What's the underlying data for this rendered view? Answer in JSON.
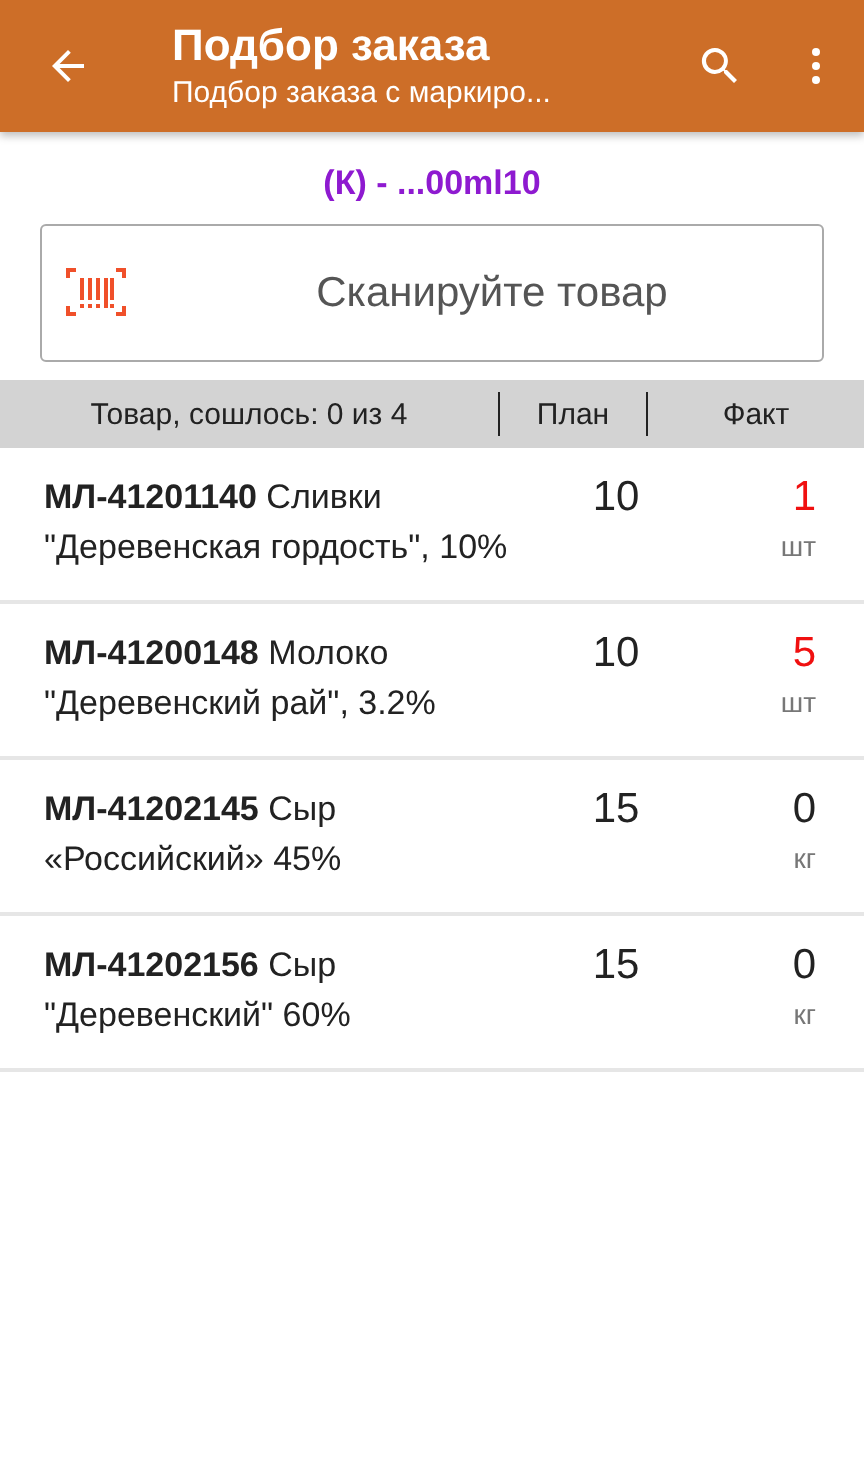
{
  "app_bar": {
    "title": "Подбор заказа",
    "subtitle": "Подбор заказа с маркиро..."
  },
  "order_code": "(К) - ...00ml10",
  "scan_field": {
    "placeholder": "Сканируйте товар"
  },
  "table": {
    "columns": [
      "Товар, сошлось: 0 из 4",
      "План",
      "Факт"
    ],
    "rows": [
      {
        "name": "**МЛ-41201140** Сливки \"Деревенская гордость\", 10%",
        "plan": "10",
        "fact": "1",
        "unit": "шт",
        "alert": true
      },
      {
        "name": "**МЛ-41200148** Молоко \"Деревенский рай\", 3.2%",
        "plan": "10",
        "fact": "5",
        "unit": "шт",
        "alert": true
      },
      {
        "name": "**МЛ-41202145** Сыр «Российский» 45%",
        "plan": "15",
        "fact": "0",
        "unit": "кг",
        "alert": false
      },
      {
        "name": "**МЛ-41202156** Сыр \"Деревенский\" 60%",
        "plan": "15",
        "fact": "0",
        "unit": "кг",
        "alert": false
      }
    ]
  }
}
